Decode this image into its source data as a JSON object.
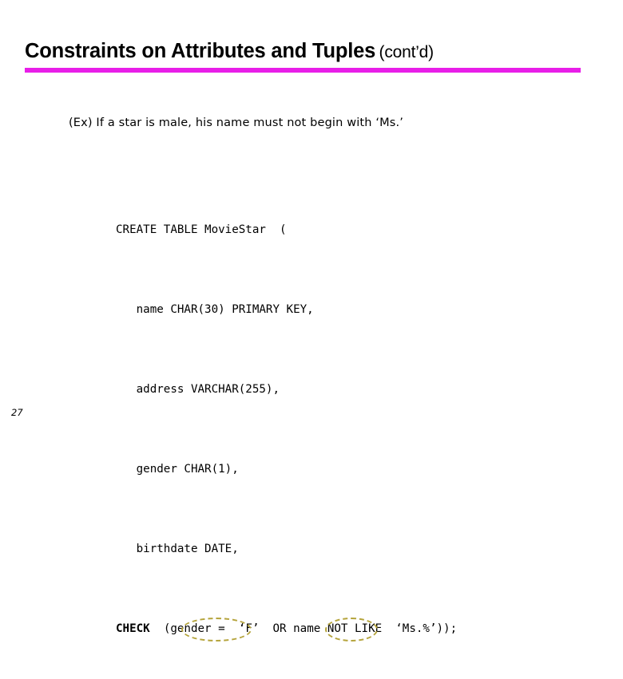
{
  "slide": {
    "title_main": "Constraints on Attributes and Tuples",
    "title_suffix": "(cont’d)",
    "rule_color": "#e81ee8",
    "page_number": "27",
    "background_color": "#ffffff"
  },
  "example": {
    "text": "(Ex) If a star is male, his name must not begin with ‘Ms.’"
  },
  "code": {
    "language": "sql",
    "lines": [
      {
        "id": "line-create",
        "text": "CREATE TABLE MovieStar  ("
      },
      {
        "id": "line-name",
        "text": "   name CHAR(30) PRIMARY KEY,"
      },
      {
        "id": "line-address",
        "text": "   address VARCHAR(255),"
      },
      {
        "id": "line-gender",
        "text": "   gender CHAR(1),"
      },
      {
        "id": "line-birthdate",
        "text": "   birthdate DATE,"
      }
    ],
    "check_line": {
      "keyword": "CHECK",
      "part_before": "  ",
      "part_gender": "(gender",
      "part_middle": " =  ‘F’  OR ",
      "part_name": "name",
      "part_after": " NOT LIKE  ‘Ms.%’));"
    }
  },
  "annotations": {
    "ellipse_color": "#b5a43c",
    "items": [
      {
        "name": "gender-circle",
        "target": "(gender"
      },
      {
        "name": "name-circle",
        "target": "name"
      }
    ]
  }
}
